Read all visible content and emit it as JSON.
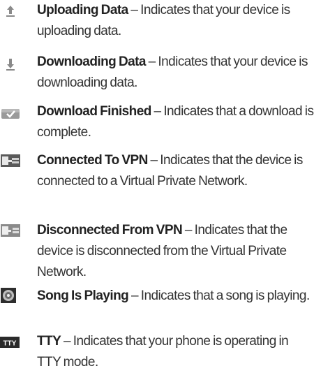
{
  "entries": [
    {
      "icon": "upload-arrow-icon",
      "term": "Uploading Data",
      "dash": " – ",
      "description": "Indicates that your device is uploading data."
    },
    {
      "icon": "download-arrow-icon",
      "term": "Downloading Data",
      "dash": " – ",
      "description": "Indicates that your device is downloading data."
    },
    {
      "icon": "download-finished-icon",
      "term": "Download Finished",
      "dash": " – ",
      "description": "Indicates that a download is complete."
    },
    {
      "icon": "vpn-connected-icon",
      "term": "Connected To VPN",
      "dash": " – ",
      "description": "Indicates that the device is connected to a Virtual Private Network."
    },
    {
      "icon": "vpn-disconnected-icon",
      "term": "Disconnected From VPN",
      "dash": " – ",
      "description": "Indicates that the device is disconnected from the Virtual Private Network."
    },
    {
      "icon": "song-playing-icon",
      "term": "Song Is Playing",
      "dash": " – ",
      "description": "Indicates that a song is playing."
    },
    {
      "icon": "tty-icon",
      "term": "TTY",
      "dash": " – ",
      "description": "Indicates that your phone is operating in TTY mode.",
      "icon_label": "TTY"
    }
  ]
}
